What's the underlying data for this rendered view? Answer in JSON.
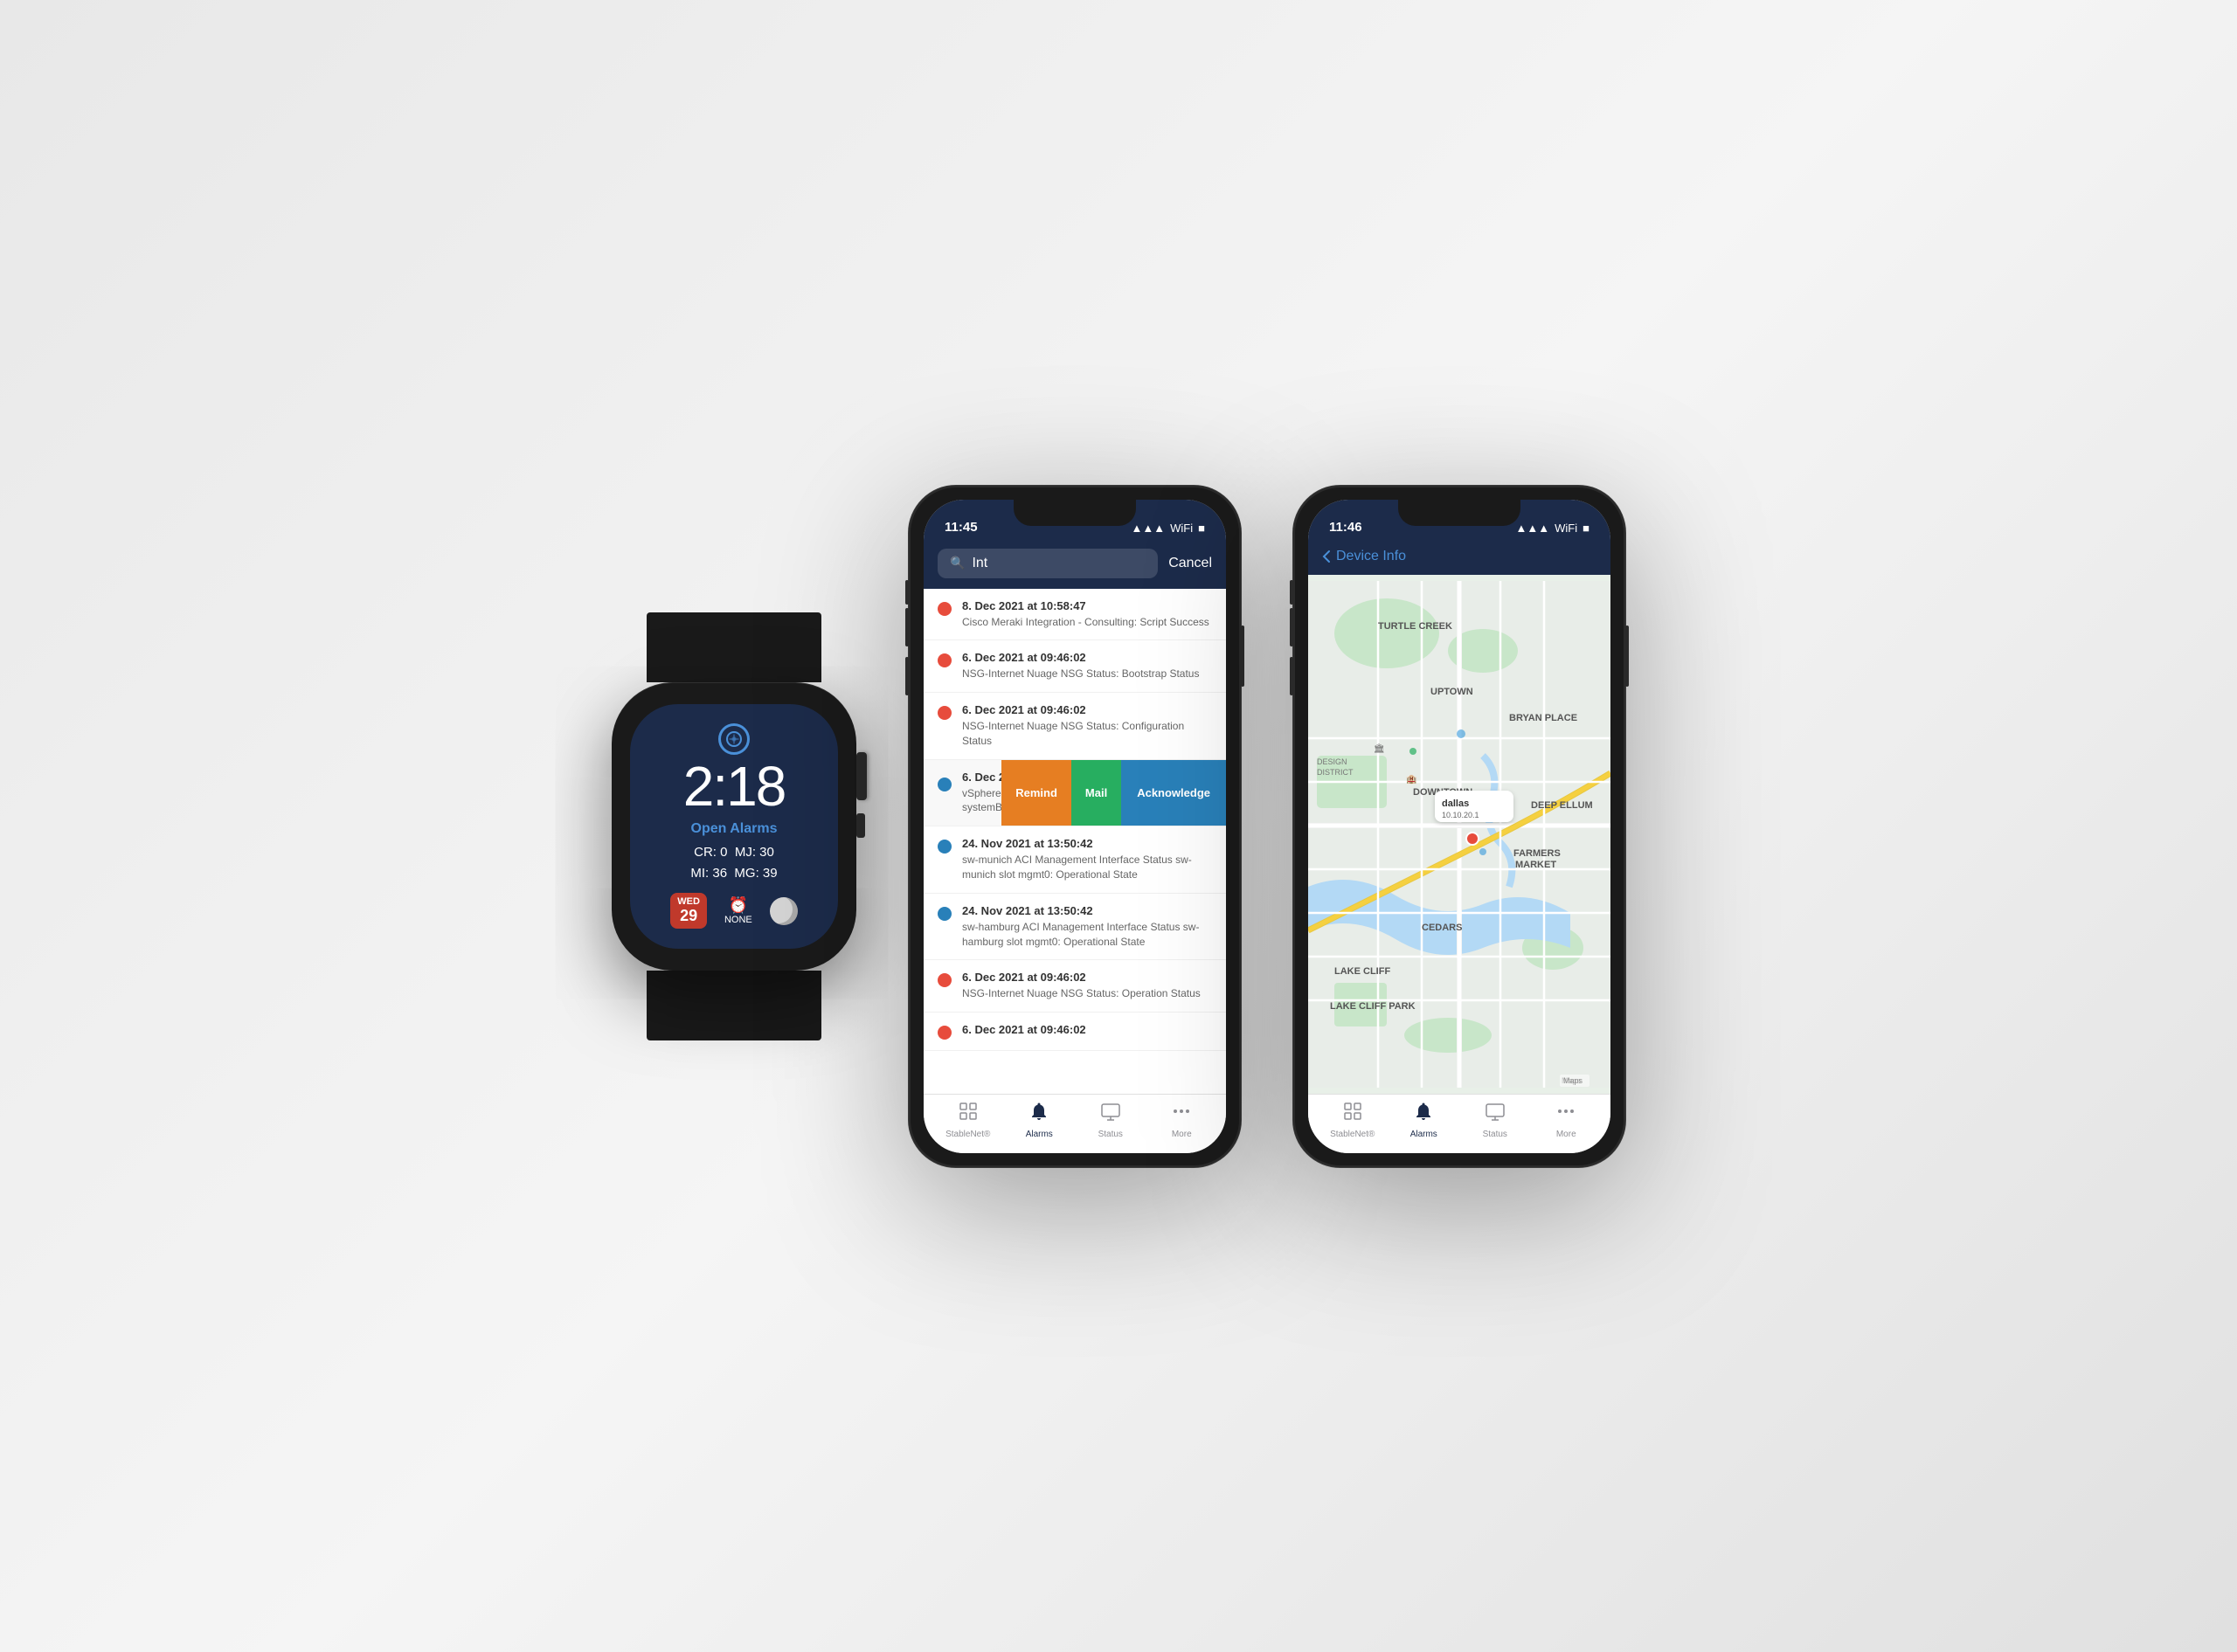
{
  "watch": {
    "time": "2:18",
    "compass_icon": "◎",
    "alarm_label": "Open Alarms",
    "cr": "CR: 0",
    "mj": "MJ: 30",
    "mi": "MI: 36",
    "mg": "MG: 39",
    "day_label": "WED",
    "day_num": "29",
    "alarm_widget_label": "NONE",
    "band_color": "#1a1a1a"
  },
  "phone1": {
    "status_time": "11:45",
    "search_placeholder": "Int",
    "cancel_label": "Cancel",
    "alarms": [
      {
        "time": "8. Dec 2021 at 10:58:47",
        "desc": "Cisco Meraki Integration - Consulting: Script Success",
        "dot": "red"
      },
      {
        "time": "6. Dec 2021 at 09:46:02",
        "desc": "NSG-Internet Nuage NSG Status: Bootstrap Status",
        "dot": "red"
      },
      {
        "time": "6. Dec 2021 at 09:46:02",
        "desc": "NSG-Internet Nuage NSG Status: Configuration Status",
        "dot": "red"
      },
      {
        "time": "6. Dec 2021 at 09:44:22",
        "desc": "vSphere-Center VMware Host Sensor 10.20.0.101 - systemBoard - System Board 11 Chassis Intru: Status",
        "dot": "blue",
        "has_actions": true
      },
      {
        "time": "24. Nov 2021 at 13:50:42",
        "desc": "sw-munich ACI Management Interface Status sw-munich slot mgmt0: Operational State",
        "dot": "blue"
      },
      {
        "time": "24. Nov 2021 at 13:50:42",
        "desc": "sw-hamburg ACI Management Interface Status sw-hamburg slot mgmt0: Operational State",
        "dot": "blue"
      },
      {
        "time": "6. Dec 2021 at 09:46:02",
        "desc": "NSG-Internet Nuage NSG Status: Operation Status",
        "dot": "red"
      },
      {
        "time": "6. Dec 2021 at 09:46:02",
        "desc": "",
        "dot": "red"
      }
    ],
    "actions": {
      "remind": "Remind",
      "mail": "Mail",
      "acknowledge": "Acknowledge"
    },
    "tabs": [
      {
        "label": "StableNet®",
        "icon": "📡",
        "active": false
      },
      {
        "label": "Alarms",
        "icon": "🔔",
        "active": true
      },
      {
        "label": "Status",
        "icon": "🖥",
        "active": false
      },
      {
        "label": "More",
        "icon": "···",
        "active": false
      }
    ]
  },
  "phone2": {
    "status_time": "11:46",
    "nav_back": "Device Info",
    "map": {
      "tooltip_name": "dallas",
      "tooltip_ip": "10.10.20.1",
      "neighborhoods": [
        "TURTLE CREEK",
        "UPTOWN",
        "BRYAN PLACE",
        "DEEP ELLUM",
        "DOWNTOWN",
        "FARMERS MARKET",
        "CEDARS",
        "LAKE CLIFF",
        "LAKE CLIFF PARK"
      ],
      "attribution": "Maps"
    },
    "tabs": [
      {
        "label": "StableNet®",
        "icon": "📡",
        "active": false
      },
      {
        "label": "Alarms",
        "icon": "🔔",
        "active": true
      },
      {
        "label": "Status",
        "icon": "🖥",
        "active": false
      },
      {
        "label": "More",
        "icon": "···",
        "active": false
      }
    ]
  }
}
